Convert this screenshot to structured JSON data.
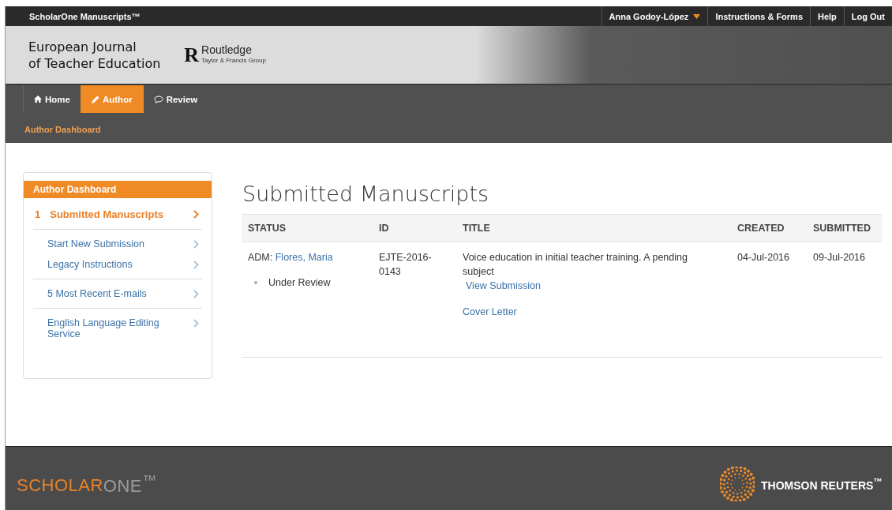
{
  "top_bar": {
    "product": "ScholarOne Manuscripts™",
    "user": "Anna Godoy-López",
    "links": [
      "Instructions & Forms",
      "Help",
      "Log Out"
    ]
  },
  "header": {
    "journal_lines": [
      "European Journal",
      "of Teacher Education"
    ],
    "publisher_mark": "R",
    "publisher": "Routledge",
    "publisher_group": "Taylor & Francis Group"
  },
  "nav": {
    "tabs": [
      {
        "label": "Home",
        "kind": "home",
        "selected": false
      },
      {
        "label": "Author",
        "kind": "pencil",
        "selected": true
      },
      {
        "label": "Review",
        "kind": "bubble",
        "selected": false
      }
    ],
    "breadcrumb": "Author Dashboard"
  },
  "sidebar": {
    "title": "Author Dashboard",
    "groups": [
      [
        {
          "count": "1",
          "label": "Submitted Manuscripts",
          "selected": true
        }
      ],
      [
        {
          "label": "Start New Submission",
          "selected": false
        },
        {
          "label": "Legacy Instructions",
          "selected": false
        }
      ],
      [
        {
          "label": "5 Most Recent E-mails",
          "selected": false
        }
      ],
      [
        {
          "label": "English Language Editing Service",
          "selected": false
        }
      ]
    ]
  },
  "main": {
    "title": "Submitted Manuscripts",
    "table": {
      "columns": [
        "STATUS",
        "ID",
        "TITLE",
        "CREATED",
        "SUBMITTED"
      ],
      "rows": [
        {
          "admin_prefix": "ADM:",
          "admin": "Flores, Maria",
          "status": "Under Review",
          "id": "EJTE-2016-0143",
          "title": "Voice education in initial teacher training. A pending subject",
          "links": [
            "View Submission",
            "Cover Letter"
          ],
          "created": "04-Jul-2016",
          "submitted": "09-Jul-2016"
        }
      ]
    }
  },
  "footer": {
    "logo_parts": [
      "SCHOLAR",
      "ONE$^{™}$"
    ],
    "brand": "THOMSON REUTERS$^{™}$"
  }
}
